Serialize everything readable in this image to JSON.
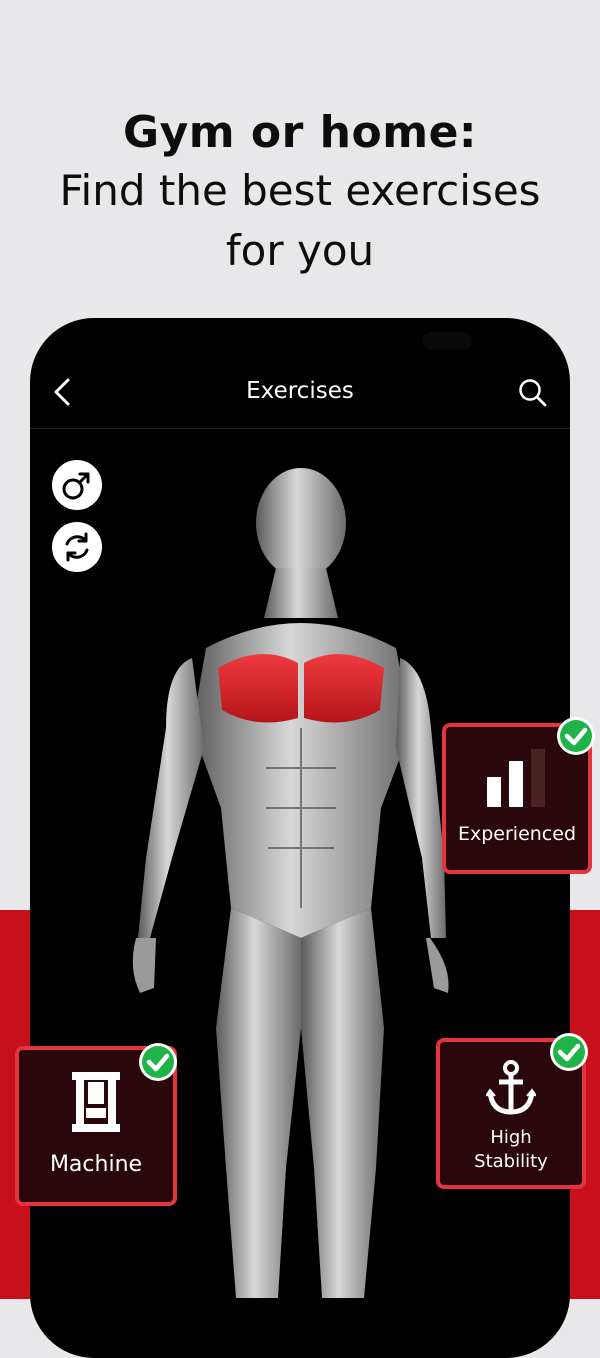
{
  "headline": {
    "line1": "Gym or home:",
    "line2": "Find the best exercises",
    "line3": "for you"
  },
  "screen": {
    "title": "Exercises",
    "back_icon": "chevron-left-icon",
    "search_icon": "search-icon",
    "gender_icon": "male-symbol-icon",
    "rotate_icon": "rotate-icon",
    "highlight_muscle": "chest",
    "highlight_color": "#d81f26"
  },
  "badges": {
    "experience": {
      "label": "Experienced",
      "icon": "bar-level-icon",
      "checked": true
    },
    "equipment": {
      "label": "Machine",
      "icon": "machine-icon",
      "checked": true
    },
    "stability_line1": "High",
    "stability_line2": "Stability",
    "stability_icon": "anchor-icon",
    "stability_checked": true
  },
  "colors": {
    "accent_red": "#c8101c",
    "badge_border": "#e2353f",
    "badge_bg": "#2a070b",
    "check_green": "#1fb34a"
  }
}
